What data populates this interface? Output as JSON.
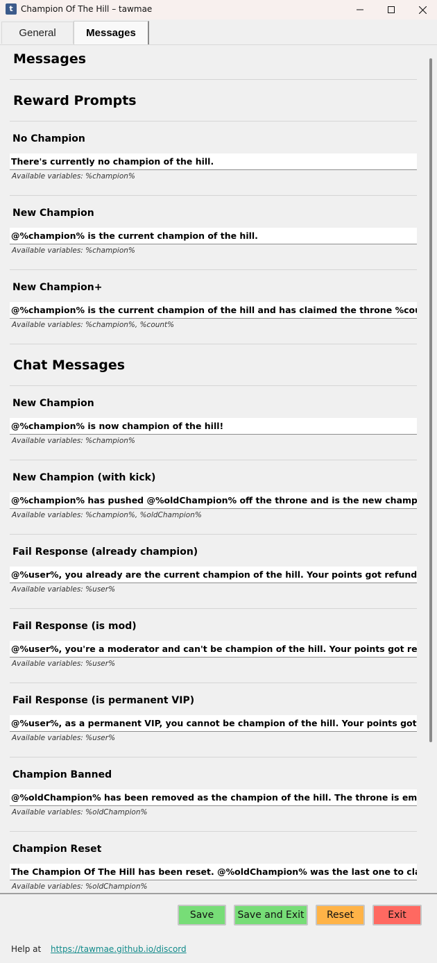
{
  "window": {
    "title": "Champion Of The Hill – tawmae",
    "icon_letter": "t"
  },
  "tabs": [
    {
      "label": "General",
      "active": false
    },
    {
      "label": "Messages",
      "active": true
    }
  ],
  "page_title": "Messages",
  "sections": {
    "reward": {
      "title": "Reward Prompts",
      "items": [
        {
          "label": "No Champion",
          "value": "There's currently no champion of the hill.",
          "hint": "Available variables: %champion%"
        },
        {
          "label": "New Champion",
          "value": "@%champion% is the current champion of the hill.",
          "hint": "Available variables: %champion%"
        },
        {
          "label": "New Champion+",
          "value": "@%champion% is the current champion of the hill and has claimed the throne %count%",
          "hint": "Available variables: %champion%, %count%"
        }
      ]
    },
    "chat": {
      "title": "Chat Messages",
      "items": [
        {
          "label": "New Champion",
          "value": "@%champion% is now champion of the hill!",
          "hint": "Available variables: %champion%"
        },
        {
          "label": "New Champion (with kick)",
          "value": "@%champion% has pushed @%oldChampion% off the throne and is the new champion",
          "hint": "Available variables: %champion%, %oldChampion%"
        },
        {
          "label": "Fail Response (already champion)",
          "value": "@%user%, you already are the current champion of the hill. Your points got refunded.",
          "hint": "Available variables: %user%"
        },
        {
          "label": "Fail Response (is mod)",
          "value": "@%user%, you're a moderator and can't be champion of the hill. Your points got refunded.",
          "hint": "Available variables: %user%"
        },
        {
          "label": "Fail Response (is permanent VIP)",
          "value": "@%user%, as a permanent VIP, you cannot be champion of the hill. Your points got refunded.",
          "hint": "Available variables: %user%"
        },
        {
          "label": "Champion Banned",
          "value": "@%oldChampion% has been removed as the champion of the hill. The throne is empty",
          "hint": "Available variables: %oldChampion%"
        },
        {
          "label": "Champion Reset",
          "value": "The Champion Of The Hill has been reset. @%oldChampion% was the last one to claim the throne.",
          "hint": "Available variables: %oldChampion%"
        }
      ]
    }
  },
  "buttons": {
    "save": "Save",
    "save_exit": "Save and Exit",
    "reset": "Reset",
    "exit": "Exit"
  },
  "footer": {
    "help_label": "Help at",
    "help_link": "https://tawmae.github.io/discord"
  },
  "colors": {
    "save": "#77dd77",
    "reset": "#ffb347",
    "exit": "#ff6961",
    "link": "#108a8a"
  },
  "icons": {
    "minimize": "minimize-icon",
    "maximize": "maximize-icon",
    "close": "close-icon"
  }
}
